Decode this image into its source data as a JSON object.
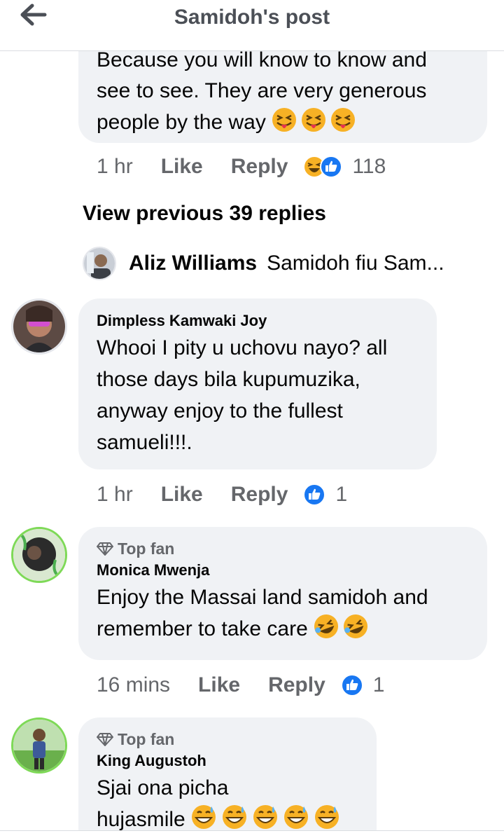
{
  "header": {
    "title": "Samidoh's post"
  },
  "icons": {
    "back": "arrow-left-icon",
    "top_fan": "diamond-icon",
    "like": "thumbs-up-icon",
    "haha": "haha-icon"
  },
  "colors": {
    "like_blue": "#1877f2",
    "bubble_bg": "#f0f2f5",
    "meta_gray": "#65676b",
    "haha_yellow": "#f7b125"
  },
  "comment0": {
    "text_line1": "Because you will know to know and",
    "text_line2": "see to see. They are very generous",
    "text_line3": "people by the way",
    "time": "1 hr",
    "like": "Like",
    "reply": "Reply",
    "reaction_count": "118"
  },
  "view_previous": "View previous 39 replies",
  "reply_preview": {
    "name": "Aliz Williams",
    "text": "Samidoh fiu Sam..."
  },
  "comment1": {
    "author": "Dimpless Kamwaki Joy",
    "line1": "Whooi I pity u uchovu nayo? all",
    "line2": "those days bila kupumuzika,",
    "line3": "anyway enjoy to the fullest",
    "line4": "samueli!!!.",
    "time": "1 hr",
    "like": "Like",
    "reply": "Reply",
    "reaction_count": "1"
  },
  "comment2": {
    "badge": "Top fan",
    "author": "Monica Mwenja",
    "line1": "Enjoy the Massai land samidoh and",
    "line2": "remember to take care",
    "time": "16 mins",
    "like": "Like",
    "reply": "Reply",
    "reaction_count": "1"
  },
  "comment3": {
    "badge": "Top fan",
    "author": "King Augustoh",
    "line1": "Sjai ona picha",
    "line2": "hujasmile"
  }
}
